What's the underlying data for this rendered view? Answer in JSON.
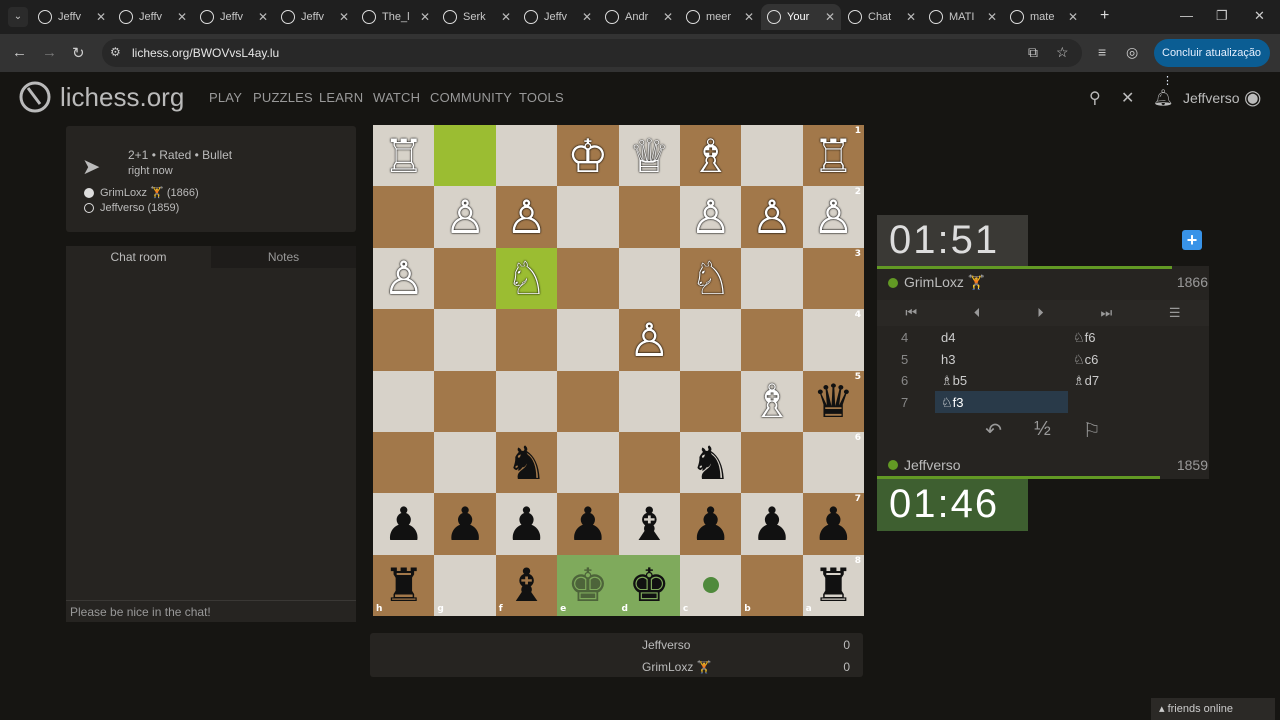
{
  "browser": {
    "tabs": [
      "Jeffv",
      "Jeffv",
      "Jeffv",
      "Jeffv",
      "The_l",
      "Serk",
      "Jeffv",
      "Andr",
      "meer",
      "Your",
      "Chat",
      "MATI",
      "mate"
    ],
    "active_tab": 9,
    "url": "lichess.org/BWOVvsL4ay.lu",
    "update_button": "Concluir atualização"
  },
  "site": {
    "logo": "lichess.org",
    "menu": [
      "PLAY",
      "PUZZLES",
      "LEARN",
      "WATCH",
      "COMMUNITY",
      "TOOLS"
    ],
    "username": "Jeffverso"
  },
  "game_info": {
    "mode": "2+1 • Rated • Bullet",
    "time": "right now",
    "white_player": "GrimLoxz 🏋 (1866)",
    "black_player": "Jeffverso (1859)"
  },
  "chat": {
    "tab_chat": "Chat room",
    "tab_notes": "Notes",
    "placeholder": "Please be nice in the chat!"
  },
  "board": {
    "rows": [
      [
        "wr",
        "",
        "",
        "wk",
        "wq",
        "wb",
        "",
        "wr"
      ],
      [
        "",
        "wp",
        "wp",
        "",
        "",
        "wp",
        "wp",
        "wp"
      ],
      [
        "wp",
        "",
        "wn",
        "",
        "",
        "wn",
        "",
        ""
      ],
      [
        "",
        "",
        "",
        "",
        "wp",
        "",
        "",
        ""
      ],
      [
        "",
        "",
        "",
        "",
        "",
        "",
        "wb",
        "bq"
      ],
      [
        "",
        "",
        "bn",
        "",
        "",
        "bn",
        "",
        ""
      ],
      [
        "bp",
        "bp",
        "bp",
        "bp",
        "bb",
        "bp",
        "bp",
        "bp"
      ],
      [
        "br",
        "",
        "bb",
        "bk*",
        "bk",
        "·",
        "",
        "br"
      ]
    ],
    "ranks": [
      "1",
      "2",
      "3",
      "4",
      "5",
      "6",
      "7",
      "8"
    ],
    "files": [
      "h",
      "g",
      "f",
      "e",
      "d",
      "c",
      "b",
      "a"
    ]
  },
  "scores": [
    {
      "name": "Jeffverso",
      "score": "0"
    },
    {
      "name": "GrimLoxz 🏋",
      "score": "0"
    }
  ],
  "clocks": {
    "top": "01:51",
    "bottom": "01:46"
  },
  "players": {
    "top": {
      "name": "GrimLoxz 🏋",
      "rating": "1866"
    },
    "bottom": {
      "name": "Jeffverso",
      "rating": "1859"
    }
  },
  "moves": [
    {
      "n": "4",
      "w": "d4",
      "b": "♘f6"
    },
    {
      "n": "5",
      "w": "h3",
      "b": "♘c6"
    },
    {
      "n": "6",
      "w": "♗b5",
      "b": "♗d7"
    },
    {
      "n": "7",
      "w": "♘f3",
      "b": ""
    }
  ],
  "footer": {
    "friends": "friends online"
  }
}
